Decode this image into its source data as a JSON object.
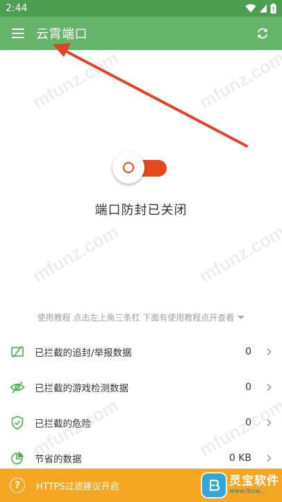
{
  "status_bar": {
    "time": "2:44"
  },
  "toolbar": {
    "title": "云霄端口",
    "menu_icon": "hamburger-menu-icon",
    "refresh_icon": "refresh-icon"
  },
  "watermark": {
    "text": "mfunz.com"
  },
  "toggle": {
    "state": "off",
    "accent_color": "#e54a1e"
  },
  "main": {
    "status_text": "端口防封已关闭",
    "tutorial_hint": "使用教程 点击左上角三条杠 下面有使用教程点开查看"
  },
  "stats": [
    {
      "icon": "blocked-tracking-icon",
      "label": "已拦截的追封/举报数据",
      "value": "0"
    },
    {
      "icon": "hidden-eye-icon",
      "label": "已拦截的游戏检测数据",
      "value": "0"
    },
    {
      "icon": "shield-check-icon",
      "label": "已拦截的危险",
      "value": "0"
    },
    {
      "icon": "pie-chart-icon",
      "label": "节省的数据",
      "value": "0 KB"
    }
  ],
  "bottom_bar": {
    "text": "HTTPS过滤建议开启",
    "help_icon": "question-circle-icon"
  },
  "brand": {
    "name": "灵宝软件",
    "url": "www.lbsw..."
  },
  "colors": {
    "status_bar": "#4e9e52",
    "toolbar": "#66b36a",
    "bottom_bar": "#f5a623",
    "annotation_arrow": "#e0432a",
    "icon_green": "#4caf50"
  }
}
